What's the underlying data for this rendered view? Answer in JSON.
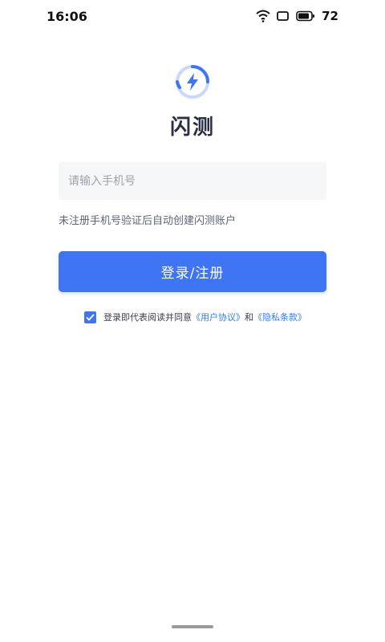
{
  "status_bar": {
    "time": "16:06",
    "battery": "72",
    "icons": [
      "wifi-icon",
      "screen-rotate-icon",
      "battery-icon"
    ]
  },
  "app": {
    "logo_icon": "lightning-bolt-icon",
    "name": "闪测"
  },
  "form": {
    "phone_placeholder": "请输入手机号",
    "phone_value": "",
    "hint": "未注册手机号验证后自动创建闪测账户",
    "submit_label": "登录/注册"
  },
  "agreement": {
    "checked": true,
    "prefix": "登录即代表阅读并同意",
    "user_agreement": "《用户协议》",
    "conjunction": "和",
    "privacy_terms": "《隐私条款》"
  },
  "colors": {
    "primary": "#3f74f3",
    "link": "#2f7cf6",
    "title": "#2b2f43"
  }
}
